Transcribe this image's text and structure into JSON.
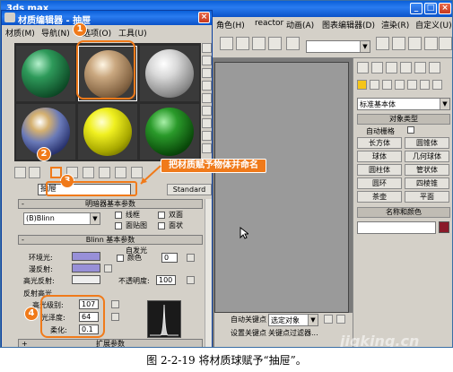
{
  "main_window": {
    "title": "3ds max",
    "menus": [
      "角色(H)",
      "reactor",
      "动画(A)",
      "图表编辑器(D)",
      "渲染(R)",
      "自定义(U)"
    ]
  },
  "material_editor": {
    "title": "材质编辑器 - 抽屉",
    "menus": [
      "材质(M)",
      "导航(N)",
      "选项(O)",
      "工具(U)"
    ],
    "material_name": "抽屉",
    "material_type": "Standard",
    "shader_rollout": "明暗器基本参数",
    "shader": "(B)Blinn",
    "shader_options": [
      "线框",
      "双面",
      "面贴图",
      "面状"
    ],
    "blinn_rollout": "Blinn 基本参数",
    "self_illum_label": "自发光",
    "color_label": "颜色",
    "self_illum_value": "0",
    "ambient_label": "环境光:",
    "diffuse_label": "漫反射:",
    "specular_label": "高光反射:",
    "opacity_label": "不透明度:",
    "opacity_value": "100",
    "highlight_title": "反射高光",
    "specular_level_label": "高光级别:",
    "specular_level_value": "107",
    "glossiness_label": "光泽度:",
    "glossiness_value": "64",
    "soften_label": "柔化:",
    "soften_value": "0.1",
    "next_rollout": "扩展参数"
  },
  "command_panel": {
    "dropdown": "标准基本体",
    "rollout_object_type": "对象类型",
    "autogrid": "自动栅格",
    "buttons": [
      "长方体",
      "圆锥体",
      "球体",
      "几何球体",
      "圆柱体",
      "管状体",
      "圆环",
      "四棱锥",
      "茶壶",
      "平面"
    ],
    "rollout_name_color": "名称和颜色"
  },
  "bottom_bar": {
    "auto_key": "自动关键点",
    "selected": "选定对象",
    "set_key": "设置关键点",
    "key_filters": "关键点过滤器..."
  },
  "callouts": {
    "one": "1",
    "two": "2",
    "three": "3",
    "four": "4",
    "tip": "把材质赋予物体并命名"
  },
  "watermark": "jiqking.cn",
  "caption": "图 2-2-19   将材质球赋予“抽屉”。"
}
